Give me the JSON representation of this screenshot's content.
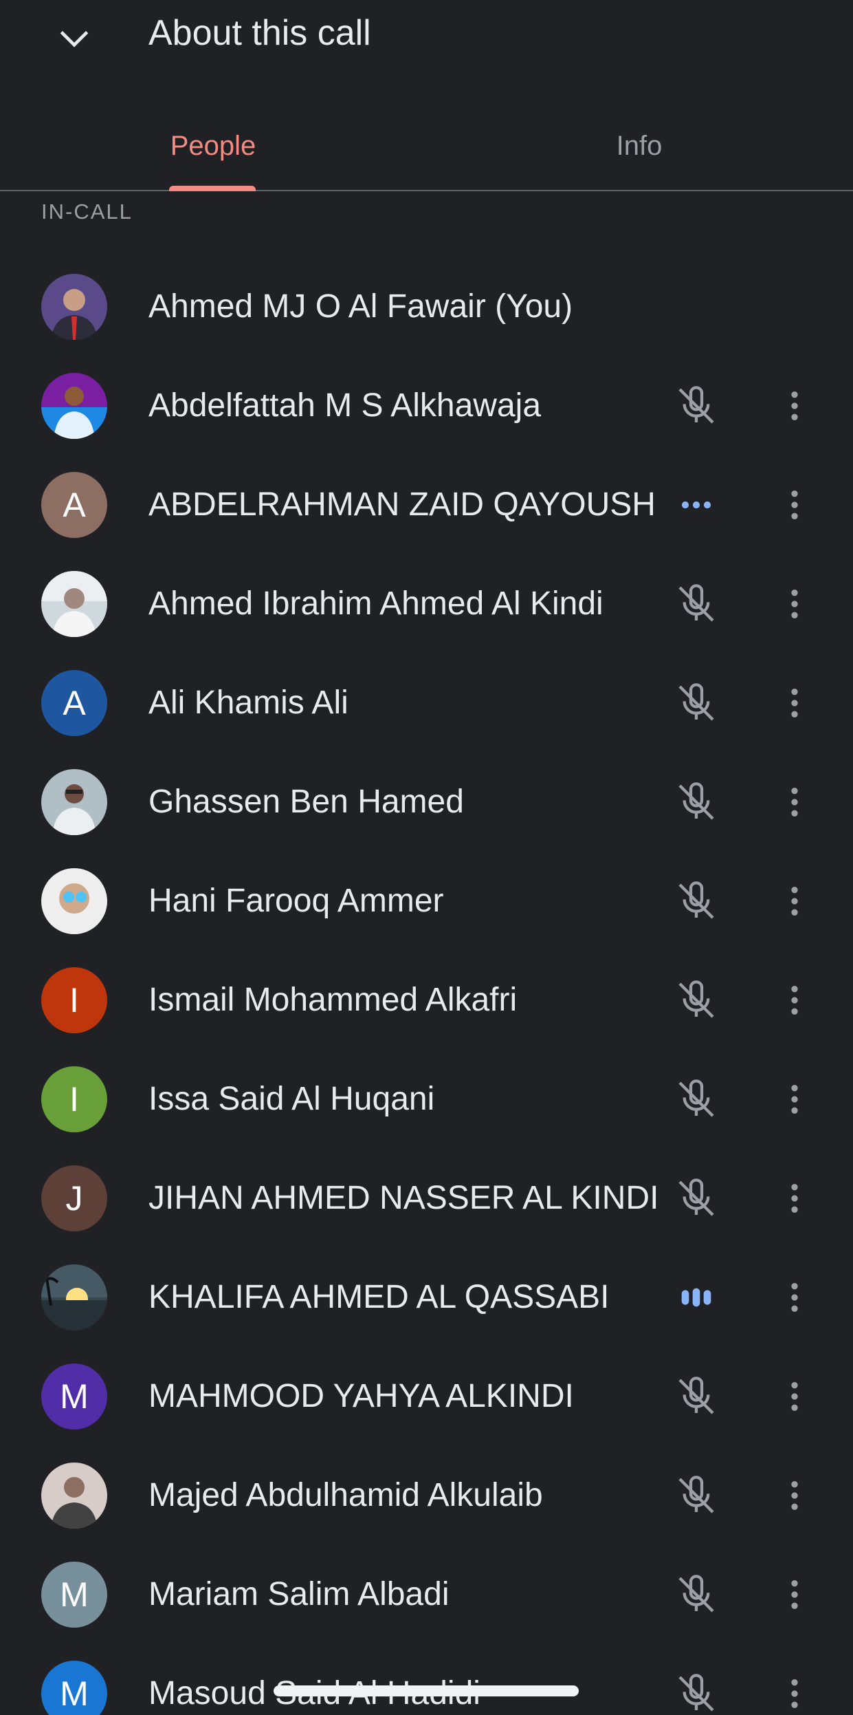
{
  "header": {
    "title": "About this call",
    "back_icon": "chevron-down-icon"
  },
  "tabs": [
    {
      "label": "People",
      "active": true
    },
    {
      "label": "Info",
      "active": false
    }
  ],
  "section_label": "IN-CALL",
  "colors": {
    "background": "#202124",
    "accent": "#f28b82",
    "speaking": "#8ab4f8",
    "muted_icon": "#9aa0a6"
  },
  "participants": [
    {
      "name": "Ahmed MJ O Al Fawair (You)",
      "avatar": "photo",
      "status": "none"
    },
    {
      "name": "Abdelfattah M S Alkhawaja",
      "avatar": "photo",
      "status": "muted"
    },
    {
      "name": "ABDELRAHMAN ZAID QAYOUSH",
      "avatar": "A",
      "avatar_color": "#8d6e63",
      "status": "connecting"
    },
    {
      "name": "Ahmed Ibrahim Ahmed Al Kindi",
      "avatar": "photo",
      "status": "muted"
    },
    {
      "name": "Ali Khamis Ali",
      "avatar": "A",
      "avatar_color": "#1e56a0",
      "status": "muted"
    },
    {
      "name": "Ghassen Ben Hamed",
      "avatar": "photo",
      "status": "muted"
    },
    {
      "name": "Hani Farooq Ammer",
      "avatar": "photo",
      "status": "muted"
    },
    {
      "name": "Ismail Mohammed Alkafri",
      "avatar": "I",
      "avatar_color": "#bf360c",
      "status": "muted"
    },
    {
      "name": "Issa Said Al Huqani",
      "avatar": "I",
      "avatar_color": "#689f38",
      "status": "muted"
    },
    {
      "name": "JIHAN AHMED NASSER AL KINDI",
      "avatar": "J",
      "avatar_color": "#5d4037",
      "status": "muted"
    },
    {
      "name": "KHALIFA AHMED AL QASSABI",
      "avatar": "photo",
      "status": "speaking"
    },
    {
      "name": "MAHMOOD YAHYA ALKINDI",
      "avatar": "M",
      "avatar_color": "#512da8",
      "status": "muted"
    },
    {
      "name": "Majed Abdulhamid Alkulaib",
      "avatar": "photo",
      "status": "muted"
    },
    {
      "name": "Mariam Salim Albadi",
      "avatar": "M",
      "avatar_color": "#78909c",
      "status": "muted"
    },
    {
      "name": "Masoud Said Al Hadidi",
      "avatar": "M",
      "avatar_color": "#1976d2",
      "status": "muted"
    }
  ]
}
